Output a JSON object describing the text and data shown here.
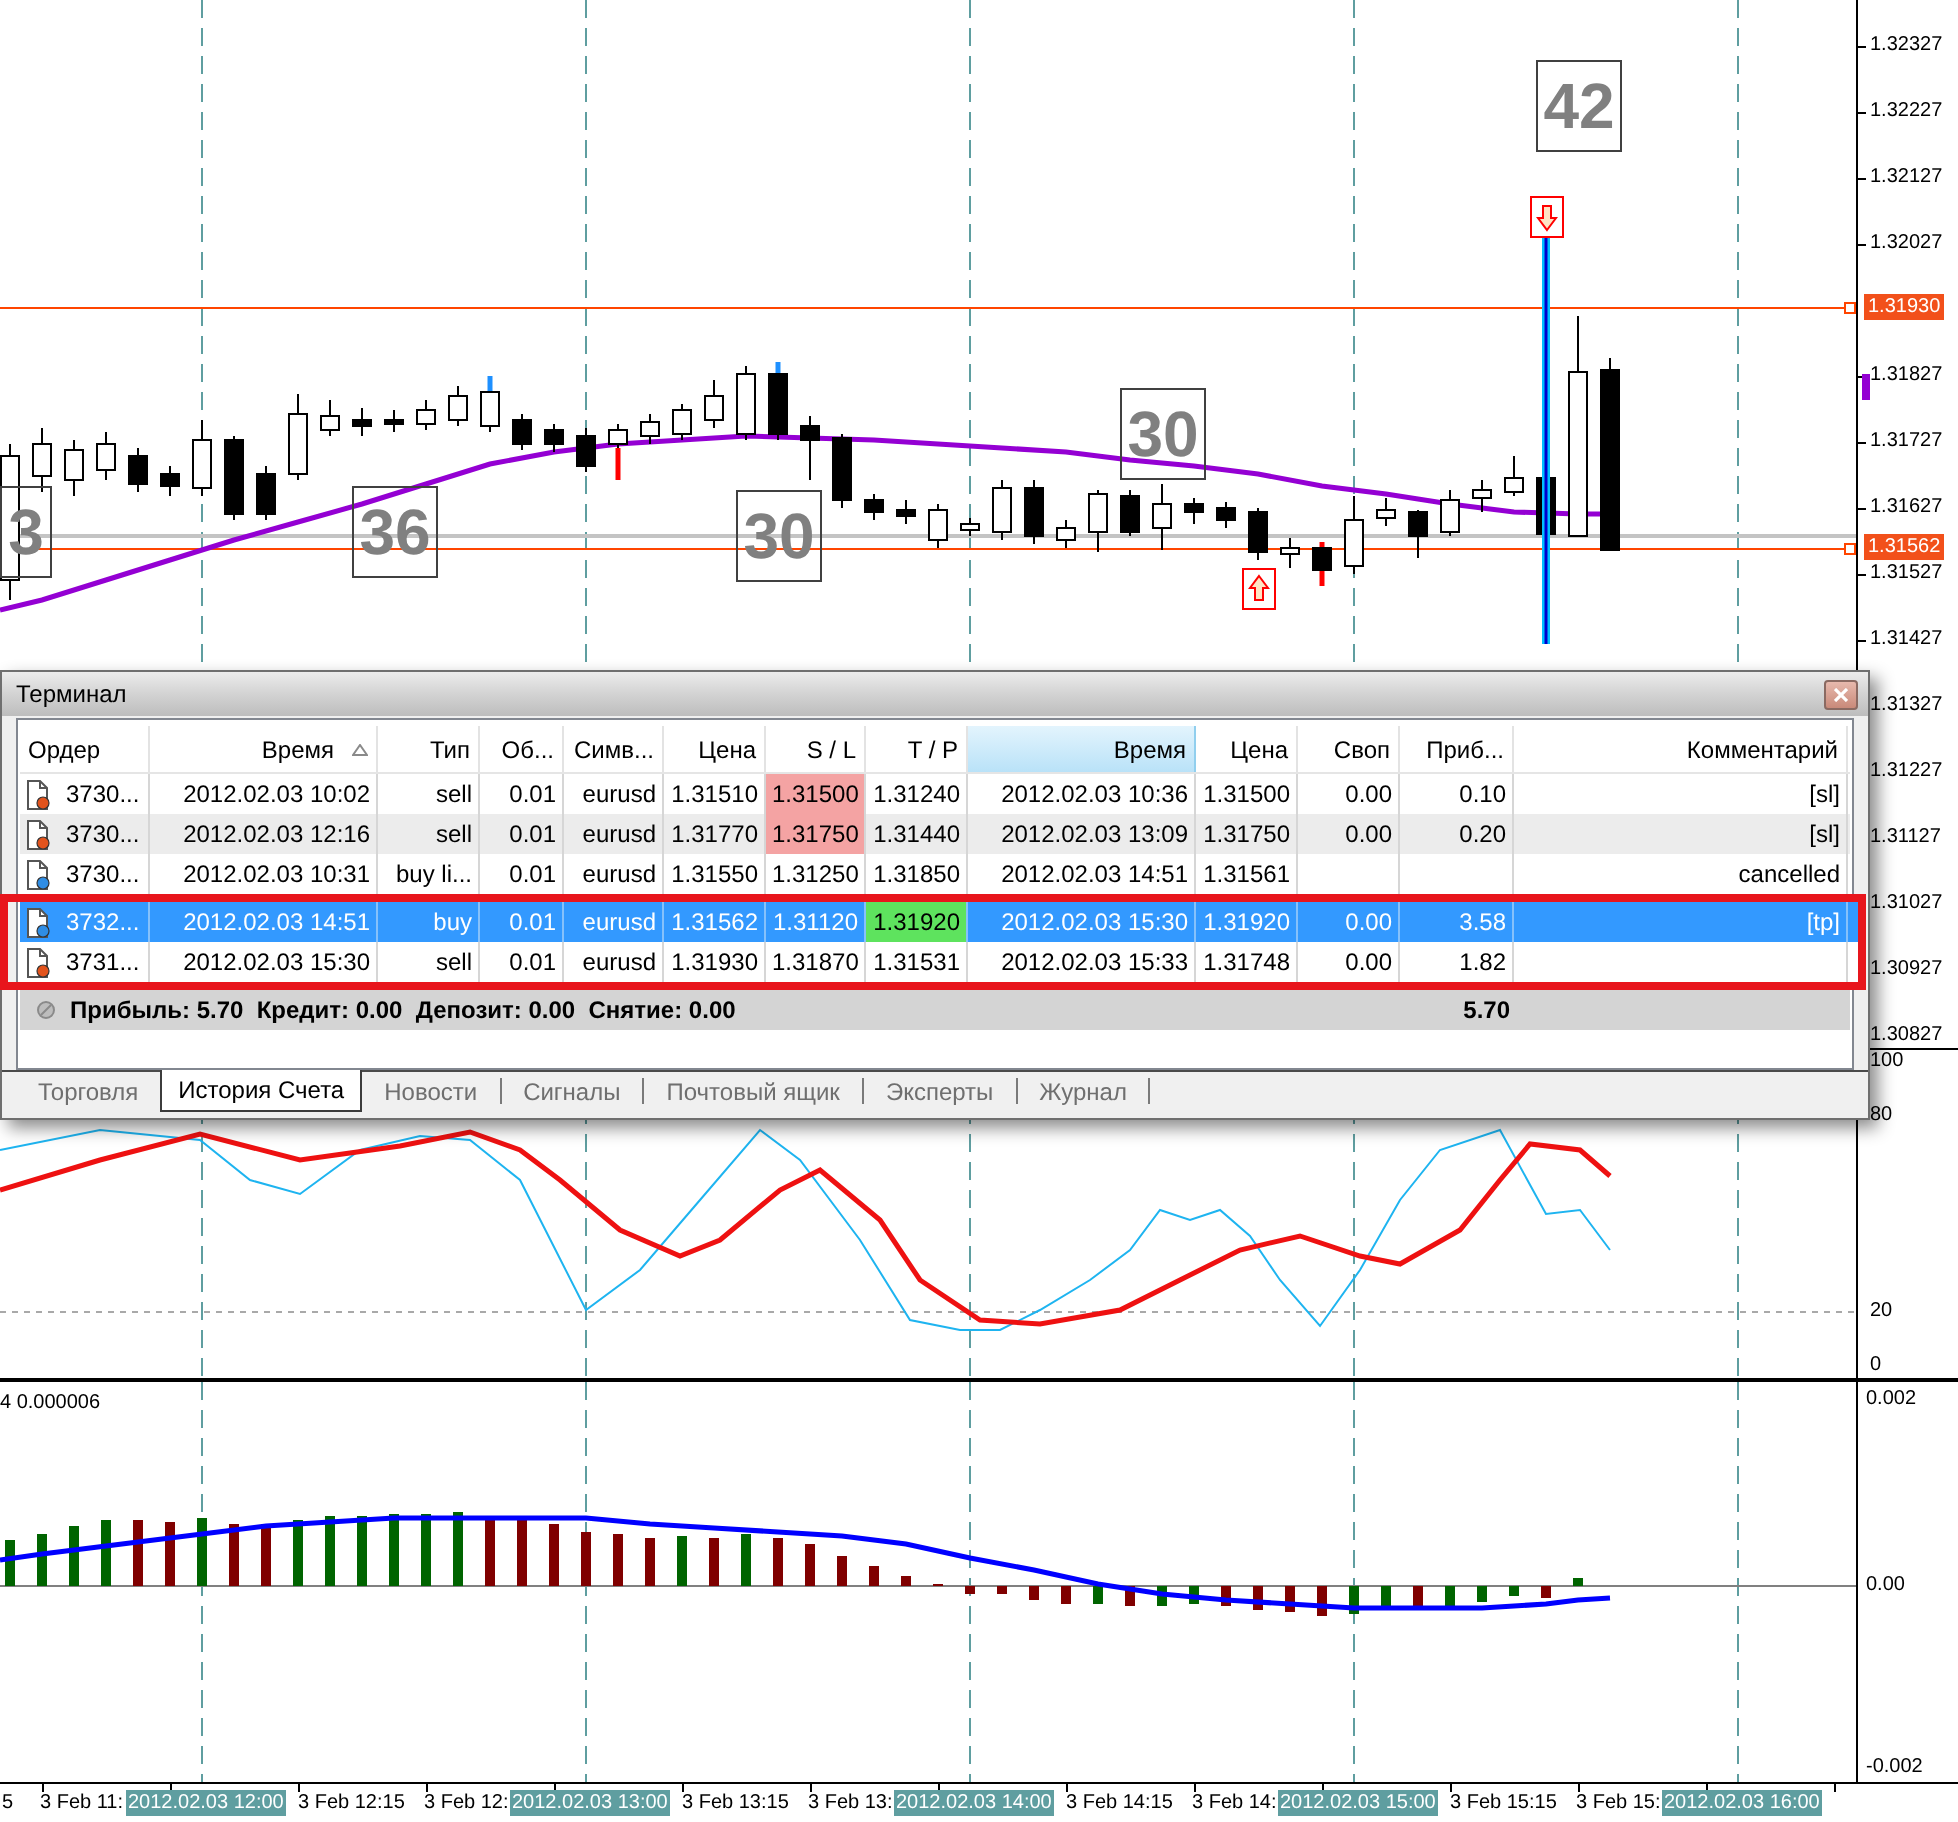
{
  "main_chart": {
    "text_labels": [
      "3",
      "36",
      "30",
      "30",
      "42"
    ],
    "price_axis": [
      "1.32327",
      "1.32227",
      "1.32127",
      "1.32027",
      "1.31827",
      "1.31727",
      "1.31627",
      "1.31527",
      "1.31427",
      "1.31327",
      "1.31227",
      "1.31127",
      "1.31027",
      "1.30927",
      "1.30827"
    ],
    "price_tags": [
      "1.31930",
      "1.31562"
    ]
  },
  "stochastic": {
    "axis": [
      "100",
      "80",
      "20",
      "0"
    ]
  },
  "macd": {
    "value_label": "4 0.000006",
    "axis": [
      "0.002",
      "0.00",
      "-0.002"
    ]
  },
  "time_axis": [
    {
      "label": "5",
      "highlighted": false
    },
    {
      "label": "3 Feb 11:",
      "highlighted": false
    },
    {
      "label": "2012.02.03 12:00",
      "highlighted": true
    },
    {
      "label": "3 Feb 12:15",
      "highlighted": false
    },
    {
      "label": "3 Feb 12:",
      "highlighted": false
    },
    {
      "label": "2012.02.03 13:00",
      "highlighted": true
    },
    {
      "label": "3 Feb 13:15",
      "highlighted": false
    },
    {
      "label": "3 Feb 13:",
      "highlighted": false
    },
    {
      "label": "2012.02.03 14:00",
      "highlighted": true
    },
    {
      "label": "3 Feb 14:15",
      "highlighted": false
    },
    {
      "label": "3 Feb 14:",
      "highlighted": false
    },
    {
      "label": "2012.02.03 15:00",
      "highlighted": true
    },
    {
      "label": "3 Feb 15:15",
      "highlighted": false
    },
    {
      "label": "3 Feb 15:",
      "highlighted": false
    },
    {
      "label": "2012.02.03 16:00",
      "highlighted": true
    }
  ],
  "terminal": {
    "title": "Терминал",
    "columns": [
      {
        "label": "Ордер",
        "sorted": false,
        "hovered": false
      },
      {
        "label": "Время",
        "sorted": true,
        "hovered": false
      },
      {
        "label": "Тип",
        "sorted": false,
        "hovered": false
      },
      {
        "label": "Об...",
        "sorted": false,
        "hovered": false
      },
      {
        "label": "Симв...",
        "sorted": false,
        "hovered": false
      },
      {
        "label": "Цена",
        "sorted": false,
        "hovered": false
      },
      {
        "label": "S / L",
        "sorted": false,
        "hovered": false
      },
      {
        "label": "T / P",
        "sorted": false,
        "hovered": false
      },
      {
        "label": "Время",
        "sorted": false,
        "hovered": true
      },
      {
        "label": "Цена",
        "sorted": false,
        "hovered": false
      },
      {
        "label": "Своп",
        "sorted": false,
        "hovered": false
      },
      {
        "label": "Приб...",
        "sorted": false,
        "hovered": false
      },
      {
        "label": "Комментарий",
        "sorted": false,
        "hovered": false
      }
    ],
    "rows": [
      {
        "kind": "sell",
        "selected": false,
        "outlined": false,
        "sl_hit": true,
        "tp_hit": false,
        "order": "3730...",
        "open_time": "2012.02.03 10:02",
        "type": "sell",
        "volume": "0.01",
        "symbol": "eurusd",
        "open_price": "1.31510",
        "sl": "1.31500",
        "tp": "1.31240",
        "close_time": "2012.02.03 10:36",
        "close_price": "1.31500",
        "swap": "0.00",
        "profit": "0.10",
        "comment": "[sl]"
      },
      {
        "kind": "sell",
        "selected": false,
        "outlined": false,
        "sl_hit": true,
        "tp_hit": false,
        "order": "3730...",
        "open_time": "2012.02.03 12:16",
        "type": "sell",
        "volume": "0.01",
        "symbol": "eurusd",
        "open_price": "1.31770",
        "sl": "1.31750",
        "tp": "1.31440",
        "close_time": "2012.02.03 13:09",
        "close_price": "1.31750",
        "swap": "0.00",
        "profit": "0.20",
        "comment": "[sl]"
      },
      {
        "kind": "buy",
        "selected": false,
        "outlined": false,
        "sl_hit": false,
        "tp_hit": false,
        "order": "3730...",
        "open_time": "2012.02.03 10:31",
        "type": "buy li...",
        "volume": "0.01",
        "symbol": "eurusd",
        "open_price": "1.31550",
        "sl": "1.31250",
        "tp": "1.31850",
        "close_time": "2012.02.03 14:51",
        "close_price": "1.31561",
        "comment": "cancelled"
      },
      {
        "kind": "buy",
        "selected": true,
        "outlined": true,
        "sl_hit": false,
        "tp_hit": true,
        "order": "3732...",
        "open_time": "2012.02.03 14:51",
        "type": "buy",
        "volume": "0.01",
        "symbol": "eurusd",
        "open_price": "1.31562",
        "sl": "1.31120",
        "tp": "1.31920",
        "close_time": "2012.02.03 15:30",
        "close_price": "1.31920",
        "swap": "0.00",
        "profit": "3.58",
        "comment": "[tp]"
      },
      {
        "kind": "sell",
        "selected": false,
        "outlined": true,
        "sl_hit": false,
        "tp_hit": false,
        "order": "3731...",
        "open_time": "2012.02.03 15:30",
        "type": "sell",
        "volume": "0.01",
        "symbol": "eurusd",
        "open_price": "1.31930",
        "sl": "1.31870",
        "tp": "1.31531",
        "close_time": "2012.02.03 15:33",
        "close_price": "1.31748",
        "swap": "0.00",
        "profit": "1.82"
      }
    ],
    "summary": {
      "text": "Прибыль: 5.70  Кредит: 0.00  Депозит: 0.00  Снятие: 0.00",
      "total": "5.70"
    },
    "tabs": [
      {
        "label": "Торговля",
        "selected": false
      },
      {
        "label": "История Счета",
        "selected": true
      },
      {
        "label": "Новости",
        "selected": false
      },
      {
        "label": "Сигналы",
        "selected": false
      },
      {
        "label": "Почтовый ящик",
        "selected": false
      },
      {
        "label": "Эксперты",
        "selected": false
      },
      {
        "label": "Журнал",
        "selected": false
      }
    ]
  }
}
